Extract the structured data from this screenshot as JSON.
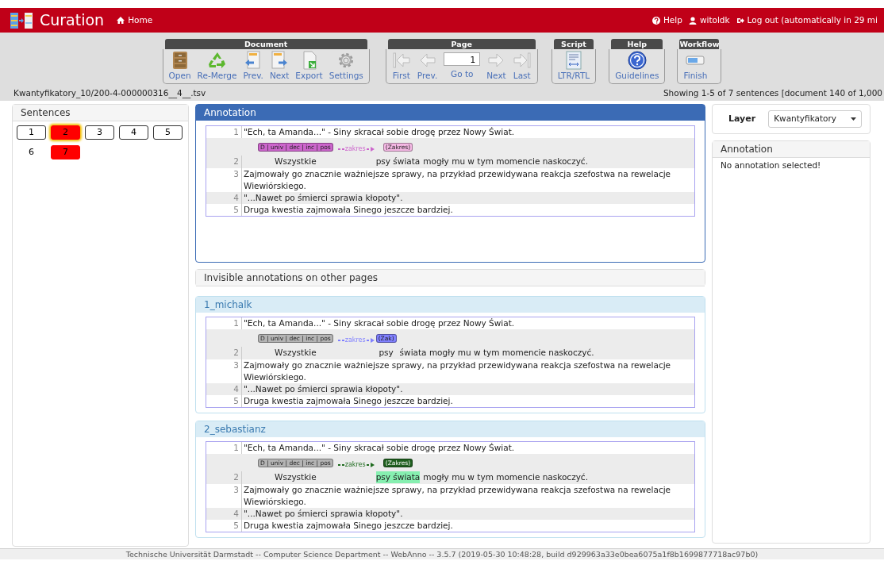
{
  "navbar": {
    "title": "Curation",
    "home": "Home",
    "links": [
      {
        "kind": "help",
        "label": "Help"
      },
      {
        "kind": "user",
        "label": "witoldk"
      },
      {
        "kind": "logout",
        "label": "Log out (automatically in 29 mi"
      }
    ]
  },
  "toolbar": [
    {
      "title": "Document",
      "buttons": [
        {
          "kind": "open",
          "label": "Open"
        },
        {
          "kind": "remerge",
          "label": "Re-Merge"
        },
        {
          "kind": "prevdoc",
          "label": "Prev."
        },
        {
          "kind": "nextdoc",
          "label": "Next"
        },
        {
          "kind": "export",
          "label": "Export"
        },
        {
          "kind": "settings",
          "label": "Settings"
        }
      ]
    },
    {
      "title": "Page",
      "buttons": [
        {
          "kind": "first",
          "label": "First"
        },
        {
          "kind": "prev",
          "label": "Prev."
        },
        {
          "kind": "goto",
          "label": "Go to",
          "value": "1"
        },
        {
          "kind": "next",
          "label": "Next"
        },
        {
          "kind": "last",
          "label": "Last"
        }
      ]
    },
    {
      "title": "Script",
      "buttons": [
        {
          "kind": "direction",
          "label": "LTR/RTL"
        }
      ]
    },
    {
      "title": "Help",
      "buttons": [
        {
          "kind": "guidelines",
          "label": "Guidelines"
        }
      ]
    },
    {
      "title": "Workflow",
      "buttons": [
        {
          "kind": "finish",
          "label": "Finish"
        }
      ]
    }
  ],
  "document_name": "Kwantyfikatory_10/200-4-000000316__4__.tsv",
  "status": "Showing 1-5 of 7 sentences [document 140 of 1,000",
  "sentences": {
    "title": "Sentences",
    "items": [
      {
        "label": "1",
        "on_page": true,
        "conflict": false,
        "selected": false
      },
      {
        "label": "2",
        "on_page": true,
        "conflict": true,
        "selected": true
      },
      {
        "label": "3",
        "on_page": true,
        "conflict": false,
        "selected": false
      },
      {
        "label": "4",
        "on_page": true,
        "conflict": false,
        "selected": false
      },
      {
        "label": "5",
        "on_page": true,
        "conflict": false,
        "selected": false
      },
      {
        "label": "6",
        "on_page": false,
        "conflict": false,
        "selected": false
      },
      {
        "label": "7",
        "on_page": false,
        "conflict": true,
        "selected": false
      }
    ]
  },
  "annotation": {
    "title": "Annotation",
    "lines": [
      {
        "number": "1",
        "kind": "plain",
        "text": "\"Ech, ta Amanda...\" - Siny skracał sobie drogę przez Nowy Świat."
      },
      {
        "number": "2",
        "kind": "annotated",
        "segments": [
          {
            "kind": "span",
            "text": "Wszystkie",
            "label": "D | univ | dec | inc | pos",
            "color": "#cc66cc"
          },
          {
            "kind": "arc",
            "label": "zakres",
            "color": "#cc66cc"
          },
          {
            "kind": "span",
            "text": "psy świata",
            "label": "(Zakres)",
            "color": "#f4b8e4"
          },
          {
            "kind": "text",
            "text": "mogły mu w tym momencie naskoczyć."
          }
        ]
      },
      {
        "number": "3",
        "kind": "plain",
        "text": "Zajmowały go znacznie ważniejsze sprawy, na przykład przewidywana reakcja szefostwa na rewelacje Wiewiórskiego."
      },
      {
        "number": "4",
        "kind": "plain",
        "text": "\"...Nawet po śmierci sprawia kłopoty\"."
      },
      {
        "number": "5",
        "kind": "plain",
        "text": "Druga kwestia zajmowała Sinego jeszcze bardziej."
      }
    ]
  },
  "invisible": {
    "title": "Invisible annotations on other pages"
  },
  "users": [
    {
      "name": "1_michalk",
      "lines": [
        {
          "number": "1",
          "kind": "plain",
          "text": "\"Ech, ta Amanda...\" - Siny skracał sobie drogę przez Nowy Świat."
        },
        {
          "number": "2",
          "kind": "annotated",
          "segments": [
            {
              "kind": "span",
              "text": "Wszystkie",
              "label": "D | univ | dec | inc | pos",
              "color": "#b4b4b4"
            },
            {
              "kind": "arc",
              "label": "zakres",
              "color": "#8080ff"
            },
            {
              "kind": "span",
              "text": "psy",
              "label": "(Zak)",
              "color": "#8080ff"
            },
            {
              "kind": "text",
              "text": "świata mogły mu w tym momencie naskoczyć."
            }
          ]
        },
        {
          "number": "3",
          "kind": "plain",
          "text": "Zajmowały go znacznie ważniejsze sprawy, na przykład przewidywana reakcja szefostwa na rewelacje Wiewiórskiego."
        },
        {
          "number": "4",
          "kind": "plain",
          "text": "\"...Nawet po śmierci sprawia kłopoty\"."
        },
        {
          "number": "5",
          "kind": "plain",
          "text": "Druga kwestia zajmowała Sinego jeszcze bardziej."
        }
      ]
    },
    {
      "name": "2_sebastianz",
      "lines": [
        {
          "number": "1",
          "kind": "plain",
          "text": "\"Ech, ta Amanda...\" - Siny skracał sobie drogę przez Nowy Świat."
        },
        {
          "number": "2",
          "kind": "annotated",
          "segments": [
            {
              "kind": "span",
              "text": "Wszystkie",
              "label": "D | univ | dec | inc | pos",
              "color": "#b4b4b4"
            },
            {
              "kind": "arc",
              "label": "zakres",
              "color": "#1f6b1f"
            },
            {
              "kind": "span",
              "text": "psy świata",
              "label": "(Zakres)",
              "color": "#1f5f1f",
              "highlighted": true
            },
            {
              "kind": "text",
              "text": "mogły mu w tym momencie naskoczyć."
            }
          ]
        },
        {
          "number": "3",
          "kind": "plain",
          "text": "Zajmowały go znacznie ważniejsze sprawy, na przykład przewidywana reakcja szefostwa na rewelacje Wiewiórskiego."
        },
        {
          "number": "4",
          "kind": "plain",
          "text": "\"...Nawet po śmierci sprawia kłopoty\"."
        },
        {
          "number": "5",
          "kind": "plain",
          "text": "Druga kwestia zajmowała Sinego jeszcze bardziej."
        }
      ]
    }
  ],
  "sidebar": {
    "layer_label": "Layer",
    "layer_value": "Kwantyfikatory",
    "annotation_title": "Annotation",
    "annotation_empty": "No annotation selected!"
  },
  "footer": "Technische Universität Darmstadt -- Computer Science Department -- WebAnno -- 3.5.7 (2019-05-30 10:48:28, build d929963a33e0bea6075a1f8b1699877718ac97b0)"
}
